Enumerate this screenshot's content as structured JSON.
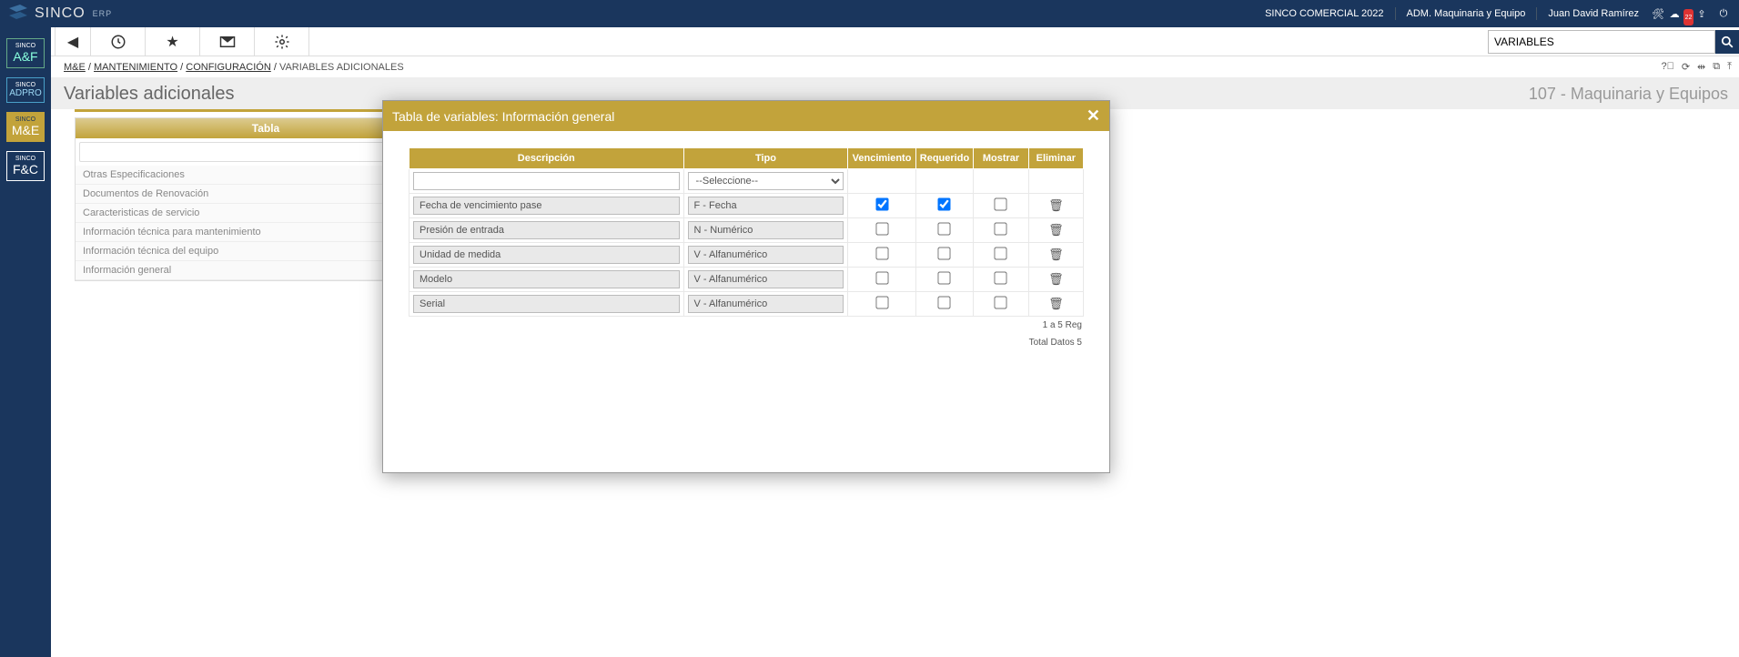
{
  "header": {
    "brand": "SINCO",
    "brand_sub": "ERP",
    "right1": "SINCO COMERCIAL 2022",
    "right2": "ADM. Maquinaria y Equipo",
    "right3": "Juan David Ramírez"
  },
  "toolbar": {
    "search_value": "VARIABLES"
  },
  "breadcrumb": {
    "b1": "M&E",
    "b2": "MANTENIMIENTO",
    "b3": "CONFIGURACIÓN",
    "b4": "VARIABLES ADICIONALES"
  },
  "title": {
    "left": "Variables adicionales",
    "right": "107 - Maquinaria y Equipos"
  },
  "sidebar": {
    "s1a": "SINCO",
    "s1b": "A&F",
    "s2a": "SINCO",
    "s2b": "ADPRO",
    "s3a": "SINCO",
    "s3b": "M&E",
    "s4a": "SINCO",
    "s4b": "F&C"
  },
  "tabla": {
    "header": "Tabla",
    "rows": [
      "Otras Especificaciones",
      "Documentos de Renovación",
      "Caracteristicas de servicio",
      "Información técnica para mantenimiento",
      "Información técnica del equipo",
      "Información general"
    ]
  },
  "modal": {
    "title": "Tabla de variables: Información general",
    "col_desc": "Descripción",
    "col_tipo": "Tipo",
    "col_venc": "Vencimiento",
    "col_req": "Requerido",
    "col_mostrar": "Mostrar",
    "col_elim": "Eliminar",
    "tipo_placeholder": "--Seleccione--",
    "rows": [
      {
        "desc": "Fecha de vencimiento pase",
        "tipo": "F - Fecha",
        "venc": true,
        "req": true,
        "mostrar": false
      },
      {
        "desc": "Presión de entrada",
        "tipo": "N - Numérico",
        "venc": false,
        "req": false,
        "mostrar": false
      },
      {
        "desc": "Unidad de medida",
        "tipo": "V - Alfanumérico",
        "venc": false,
        "req": false,
        "mostrar": false
      },
      {
        "desc": "Modelo",
        "tipo": "V - Alfanumérico",
        "venc": false,
        "req": false,
        "mostrar": false
      },
      {
        "desc": "Serial",
        "tipo": "V - Alfanumérico",
        "venc": false,
        "req": false,
        "mostrar": false
      }
    ],
    "footer1": "1 a 5 Reg",
    "footer2": "Total Datos 5"
  }
}
